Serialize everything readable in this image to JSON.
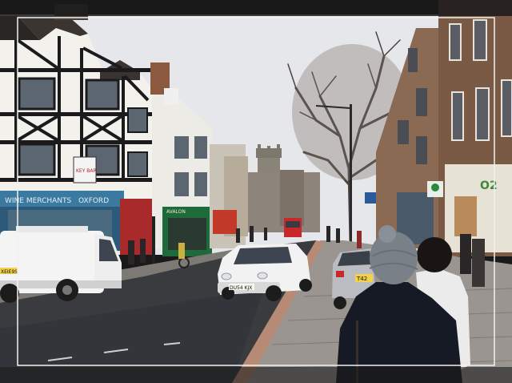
{
  "signs": {
    "shop_left": "WINE MERCHANTS",
    "shop_left2": "OXFORD",
    "key_bar": "KEY BAR",
    "green_shop": "AVALON",
    "right_shop": "O2",
    "plate_left": "XEIE9S",
    "plate_centre": "DU54 KJX",
    "plate_right": "T42"
  },
  "colors": {
    "sky": "#e8e9ec",
    "frame": "#1a1a1a",
    "frame_line": "#f2f2f2",
    "tudor_white": "#f4f2ee",
    "timber": "#1b1b1d",
    "brick": "#8a6a52",
    "road": "#3a3b3f",
    "pavement": "#8f8c88",
    "green_shop": "#1e6a3a",
    "shop_blue": "#2d5a7a"
  }
}
